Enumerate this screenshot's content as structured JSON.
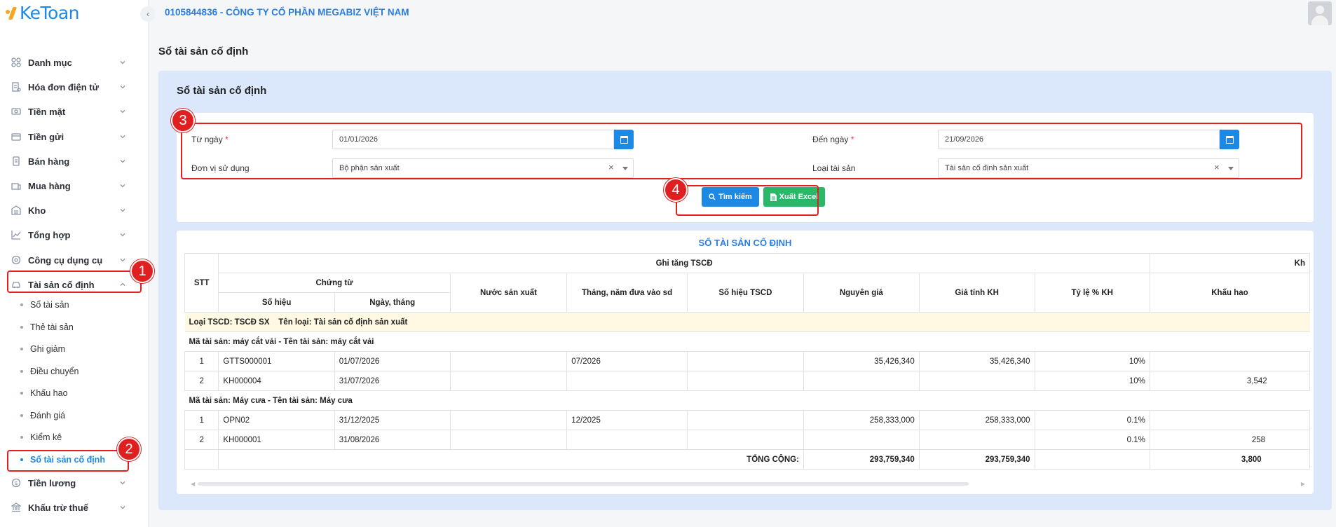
{
  "app": {
    "logo_text": "KeToan",
    "collapse_icon": "chevron-left-icon"
  },
  "header": {
    "company": "0105844836 - CÔNG TY CỔ PHẦN MEGABIZ VIỆT NAM"
  },
  "sidebar": {
    "items": [
      {
        "label": "Danh mục",
        "icon": "grid-icon"
      },
      {
        "label": "Hóa đơn điện tử",
        "icon": "invoice-icon"
      },
      {
        "label": "Tiền mặt",
        "icon": "cash-icon"
      },
      {
        "label": "Tiền gửi",
        "icon": "bank-card-icon"
      },
      {
        "label": "Bán hàng",
        "icon": "sales-icon"
      },
      {
        "label": "Mua hàng",
        "icon": "purchase-icon"
      },
      {
        "label": "Kho",
        "icon": "warehouse-icon"
      },
      {
        "label": "Tổng hợp",
        "icon": "chart-line-icon"
      },
      {
        "label": "Công cụ dụng cụ",
        "icon": "tools-icon"
      },
      {
        "label": "Tài sản cố định",
        "icon": "car-icon"
      }
    ],
    "sub_items": [
      {
        "label": "Sổ tài sản"
      },
      {
        "label": "Thẻ tài sản"
      },
      {
        "label": "Ghi giảm"
      },
      {
        "label": "Điều chuyển"
      },
      {
        "label": "Khấu hao"
      },
      {
        "label": "Đánh giá"
      },
      {
        "label": "Kiểm kê"
      },
      {
        "label": "Sổ tài sản cố định"
      }
    ],
    "bottom_items": [
      {
        "label": "Tiền lương",
        "icon": "dollar-circle-icon"
      },
      {
        "label": "Khấu trừ thuế",
        "icon": "bank-icon"
      }
    ]
  },
  "page": {
    "title": "Sổ tài sản cố định",
    "card_title": "Sổ tài sản cố định"
  },
  "filters": {
    "from_date_label": "Từ ngày",
    "from_date_value": "01/01/2026",
    "to_date_label": "Đến ngày",
    "to_date_value": "21/09/2026",
    "unit_label": "Đơn vị sử dụng",
    "unit_value": "Bộ phận sản xuất",
    "asset_type_label": "Loại tài sản",
    "asset_type_value": "Tài sản cố định sản xuất",
    "required_mark": "*",
    "clear_mark": "×"
  },
  "buttons": {
    "search": "Tìm kiếm",
    "export": "Xuất Excel"
  },
  "report": {
    "title": "SỔ TÀI SẢN CỐ ĐỊNH",
    "headers": {
      "stt": "STT",
      "ghi_tang": "Ghi tăng TSCĐ",
      "khau_hao_group": "Kh",
      "chung_tu": "Chứng từ",
      "so_hieu": "Số hiệu",
      "ngay_thang": "Ngày, tháng",
      "nuoc_sx": "Nước sản xuất",
      "thang_nam": "Tháng, năm đưa vào sd",
      "so_hieu_tscd": "Số hiệu TSCD",
      "nguyen_gia": "Nguyên giá",
      "gia_tinh_kh": "Giá tính KH",
      "ty_le": "Tỷ lệ % KH",
      "khau_hao": "Khấu hao"
    },
    "group_row": "Loại TSCD: TSCĐ SX    Tên loại: Tài sản cố định sản xuất",
    "asset_groups": [
      {
        "title": "Mã tài sản: máy cắt vải - Tên tài sản: máy cắt vải",
        "rows": [
          {
            "stt": "1",
            "so_hieu": "GTTS000001",
            "ngay": "01/07/2026",
            "nuoc": "",
            "thang_nam": "07/2026",
            "so_hieu_tscd": "",
            "nguyen_gia": "35,426,340",
            "gia_tinh": "35,426,340",
            "ty_le": "10%",
            "khau_hao": ""
          },
          {
            "stt": "2",
            "so_hieu": "KH000004",
            "ngay": "31/07/2026",
            "nuoc": "",
            "thang_nam": "",
            "so_hieu_tscd": "",
            "nguyen_gia": "",
            "gia_tinh": "",
            "ty_le": "10%",
            "khau_hao": "3,542"
          }
        ]
      },
      {
        "title": "Mã tài sản: Máy cưa - Tên tài sản: Máy cưa",
        "rows": [
          {
            "stt": "1",
            "so_hieu": "OPN02",
            "ngay": "31/12/2025",
            "nuoc": "",
            "thang_nam": "12/2025",
            "so_hieu_tscd": "",
            "nguyen_gia": "258,333,000",
            "gia_tinh": "258,333,000",
            "ty_le": "0.1%",
            "khau_hao": ""
          },
          {
            "stt": "2",
            "so_hieu": "KH000001",
            "ngay": "31/08/2026",
            "nuoc": "",
            "thang_nam": "",
            "so_hieu_tscd": "",
            "nguyen_gia": "",
            "gia_tinh": "",
            "ty_le": "0.1%",
            "khau_hao": "258"
          }
        ]
      }
    ],
    "total": {
      "label": "TỔNG CỘNG:",
      "nguyen_gia": "293,759,340",
      "gia_tinh": "293,759,340",
      "khau_hao": "3,800"
    }
  },
  "annotations": {
    "b1": "1",
    "b2": "2",
    "b3": "3",
    "b4": "4",
    "color": "#e02020"
  }
}
